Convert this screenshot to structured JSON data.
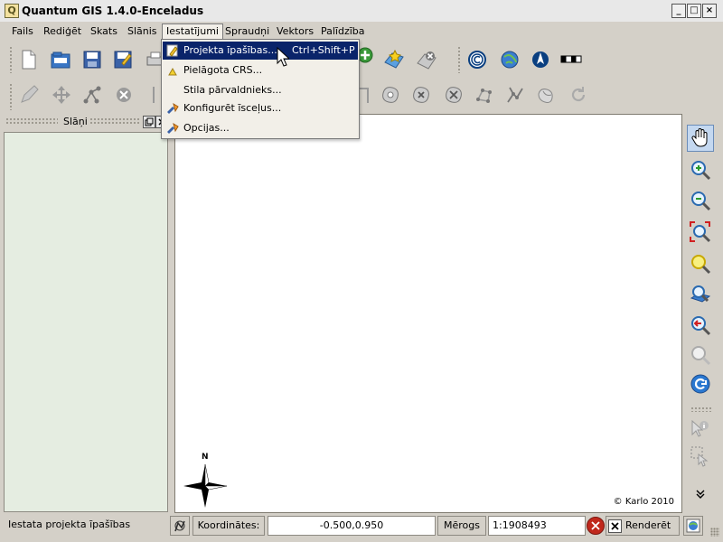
{
  "window": {
    "title": "Quantum GIS 1.4.0-Enceladus",
    "app_icon": "Q",
    "controls": [
      "_",
      "□",
      "×"
    ]
  },
  "menubar": {
    "items": [
      "Fails",
      "Rediģēt",
      "Skats",
      "Slānis",
      "Iestatījumi",
      "Spraudņi",
      "Vektors",
      "Palīdzība"
    ],
    "open_item": "Iestatījumi"
  },
  "dropdown": {
    "items": [
      {
        "label": "Projekta īpašības...",
        "shortcut": "Ctrl+Shift+P",
        "icon": "project-properties-icon",
        "highlighted": true
      },
      {
        "label": "Pielāgota CRS...",
        "shortcut": "",
        "icon": "custom-crs-icon",
        "highlighted": false
      },
      {
        "label": "Stila pārvaldnieks...",
        "shortcut": "",
        "icon": "",
        "highlighted": false
      },
      {
        "label": "Konfigurēt īsceļus...",
        "shortcut": "",
        "icon": "configure-shortcuts-icon",
        "highlighted": false
      },
      {
        "label": "Opcijas...",
        "shortcut": "",
        "icon": "options-icon",
        "highlighted": false
      }
    ]
  },
  "layers_panel": {
    "title": "Slāņi"
  },
  "map": {
    "credit": "© Karlo 2010",
    "north_label": "N"
  },
  "statusbar": {
    "message": "Iestata projekta īpašības",
    "coords_label": "Koordinātes:",
    "coords_value": "-0.500,0.950",
    "scale_label": "Mērogs",
    "scale_value": "1:1908493",
    "render_label": "Renderēt",
    "render_checked": true
  },
  "colors": {
    "highlight": "#0a246a",
    "chrome": "#d4d0c8",
    "panel": "#e5ede1",
    "stop": "#c0281c"
  }
}
